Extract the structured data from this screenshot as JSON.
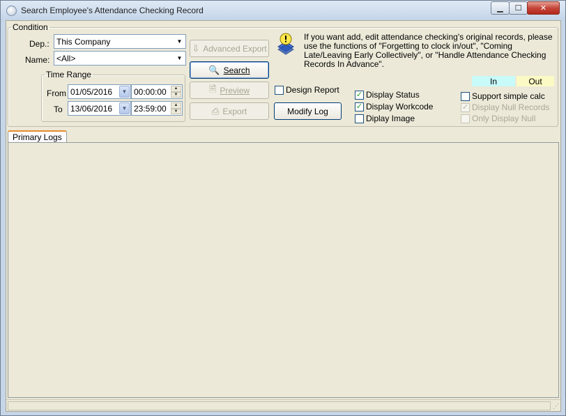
{
  "window": {
    "title": "Search Employee's Attendance Checking Record",
    "buttons": {
      "minimize": "▁",
      "maximize": "☐",
      "close": "✕"
    }
  },
  "condition": {
    "legend": "Condition",
    "dep_label": "Dep.:",
    "dep_value": "This Company",
    "name_label": "Name:",
    "name_value": "<All>",
    "time_range": {
      "legend": "Time Range",
      "from_label": "From",
      "from_date": "01/05/2016",
      "from_time": "00:00:00",
      "to_label": "To",
      "to_date": "13/06/2016",
      "to_time": "23:59:00"
    },
    "buttons": {
      "advanced_export": "Advanced Export",
      "search": "Search",
      "preview": "Preview",
      "export": "Export",
      "modify_log": "Modify Log"
    },
    "design_report": "Design Report",
    "info_text": "If you want add, edit attendance checking's original records, please use the functions of \"Forgetting to clock in/out\", \"Coming Late/Leaving Early Collectively\", or \"Handle Attendance Checking Records In Advance\".",
    "legend_in": "In",
    "legend_out": "Out",
    "colors": {
      "in": "#c8fafa",
      "out": "#fbfac4"
    },
    "options": {
      "display_status": {
        "label": "Display Status",
        "checked": true
      },
      "display_workcode": {
        "label": "Display Workcode",
        "checked": true
      },
      "display_image": {
        "label": "Diplay Image",
        "checked": false
      },
      "support_simple_calc": {
        "label": "Support simple calc",
        "checked": false
      },
      "display_null_records": {
        "label": "Display Null Records",
        "checked": true,
        "disabled": true
      },
      "only_display_null": {
        "label": "Only Display Null",
        "checked": false,
        "disabled": true
      }
    },
    "check_mark": "✓"
  },
  "tabs": [
    {
      "label": "Primary Logs",
      "active": true
    }
  ],
  "icons": {
    "combo_arrow": "▼",
    "spin_up": "▲",
    "spin_down": "▼",
    "advanced_export_icon": "⇩",
    "search_icon": "🔍",
    "preview_icon": "🗎",
    "export_icon": "⎙",
    "resize_grip": "⋰"
  }
}
